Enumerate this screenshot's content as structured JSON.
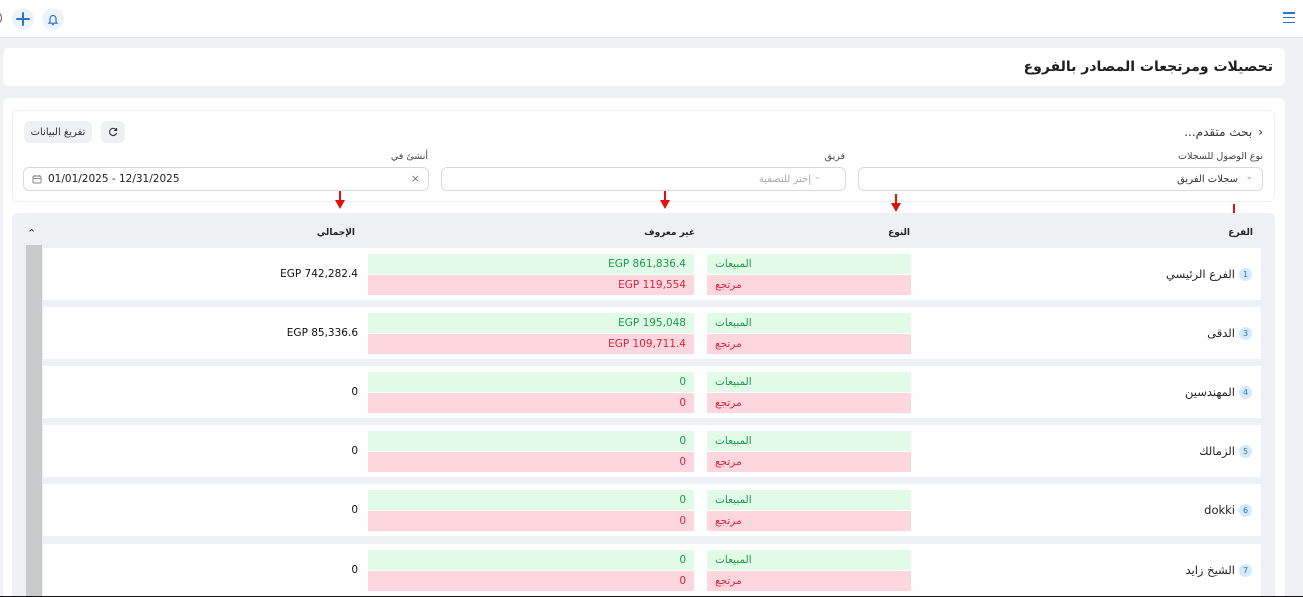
{
  "page_title": "تحصيلات ومرتجعات المصادر بالفروع",
  "toolbar": {
    "add_icon": "plus-icon",
    "bell_icon": "bell-icon",
    "menu_icon": "hamburger-menu-icon"
  },
  "filters": {
    "export_label": "تفريغ البيانات",
    "advanced_search": "بحث متقدم...",
    "access_type_label": "نوع الوصول للسجلات",
    "access_type_value": "سجلات الفريق",
    "team_label": "فريق",
    "team_placeholder": "إختر للتصفية",
    "created_label": "أنشئ في",
    "date_range": "01/01/2025 - 12/31/2025"
  },
  "table": {
    "headers": {
      "branch": "الفرع",
      "type": "النوع",
      "unknown": "غير معروف",
      "total": "الإجمالي"
    },
    "rows": [
      {
        "num": "1",
        "branch": "الفرع الرئيسي",
        "sales_label": "المبيعات",
        "return_label": "مرتجع",
        "sales_amount": "EGP 861,836.4",
        "return_amount": "EGP 119,554",
        "total": "EGP 742,282.4"
      },
      {
        "num": "3",
        "branch": "الدقى",
        "sales_label": "المبيعات",
        "return_label": "مرتجع",
        "sales_amount": "EGP 195,048",
        "return_amount": "EGP 109,711.4",
        "total": "EGP 85,336.6"
      },
      {
        "num": "4",
        "branch": "المهندسين",
        "sales_label": "المبيعات",
        "return_label": "مرتجع",
        "sales_amount": "0",
        "return_amount": "0",
        "total": "0"
      },
      {
        "num": "5",
        "branch": "الزمالك",
        "sales_label": "المبيعات",
        "return_label": "مرتجع",
        "sales_amount": "0",
        "return_amount": "0",
        "total": "0"
      },
      {
        "num": "6",
        "branch": "dokki",
        "sales_label": "المبيعات",
        "return_label": "مرتجع",
        "sales_amount": "0",
        "return_amount": "0",
        "total": "0"
      },
      {
        "num": "7",
        "branch": "الشيخ زايد",
        "sales_label": "المبيعات",
        "return_label": "مرتجع",
        "sales_amount": "0",
        "return_amount": "0",
        "total": "0"
      }
    ]
  },
  "colors": {
    "accent": "#2a74c9",
    "sales_bg": "#e1fbe8",
    "sales_text": "#1e9a4b",
    "return_bg": "#fdd6de",
    "return_text": "#d6253d",
    "annotation_arrow": "#e01010"
  }
}
